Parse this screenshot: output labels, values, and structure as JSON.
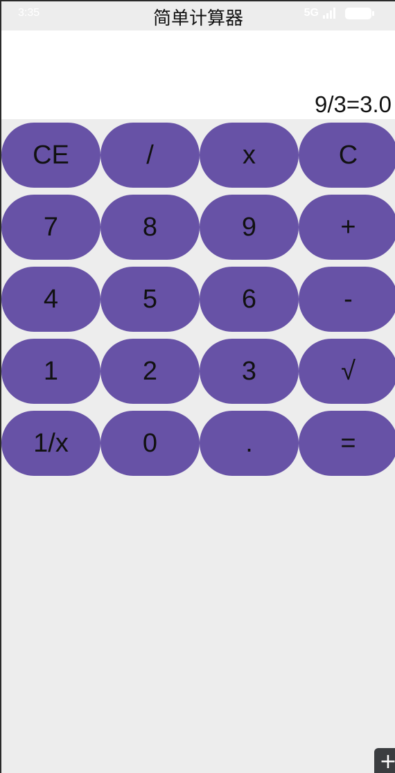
{
  "status_bar": {
    "time": "3:35",
    "network": "5G",
    "signal_icon": "signal-icon",
    "battery_icon": "battery-icon"
  },
  "app": {
    "title": "简单计算器"
  },
  "display": {
    "text": "9/3=3.0"
  },
  "keys": {
    "row1": [
      "CE",
      "/",
      "x",
      "C"
    ],
    "row2": [
      "7",
      "8",
      "9",
      "+"
    ],
    "row3": [
      "4",
      "5",
      "6",
      "-"
    ],
    "row4": [
      "1",
      "2",
      "3",
      "√"
    ],
    "row5": [
      "1/x",
      "0",
      ".",
      "="
    ]
  },
  "fab": {
    "icon": "plus-icon",
    "symbol": "+"
  },
  "colors": {
    "key_background": "#6752a6",
    "app_background": "#ededed",
    "display_background": "#ffffff"
  }
}
